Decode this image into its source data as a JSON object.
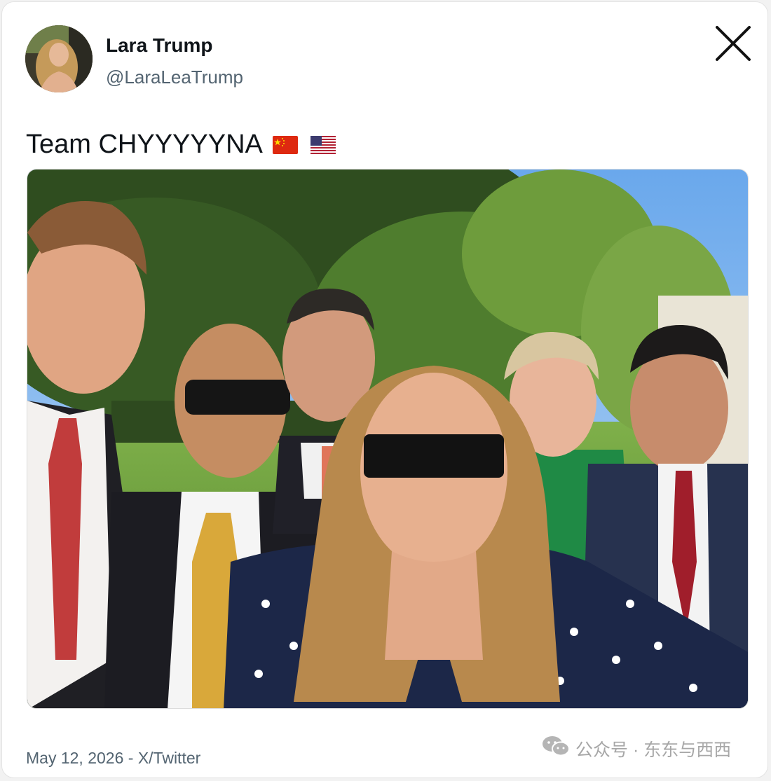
{
  "author": {
    "display_name": "Lara Trump",
    "handle": "@LaraLeaTrump"
  },
  "post": {
    "text": "Team CHYYYYYNA",
    "emoji": [
      "flag-china-icon",
      "flag-usa-icon"
    ]
  },
  "footer": {
    "timestamp": "May 12, 2026",
    "separator": " - ",
    "source": "X/Twitter"
  },
  "watermark": {
    "text": "公众号 · 东东与西西",
    "icon": "wechat-icon"
  },
  "icons": {
    "close": "close-icon"
  },
  "colors": {
    "text_primary": "#0f1419",
    "text_secondary": "#536471",
    "watermark": "#a7a7a7",
    "card_background": "#ffffff"
  }
}
